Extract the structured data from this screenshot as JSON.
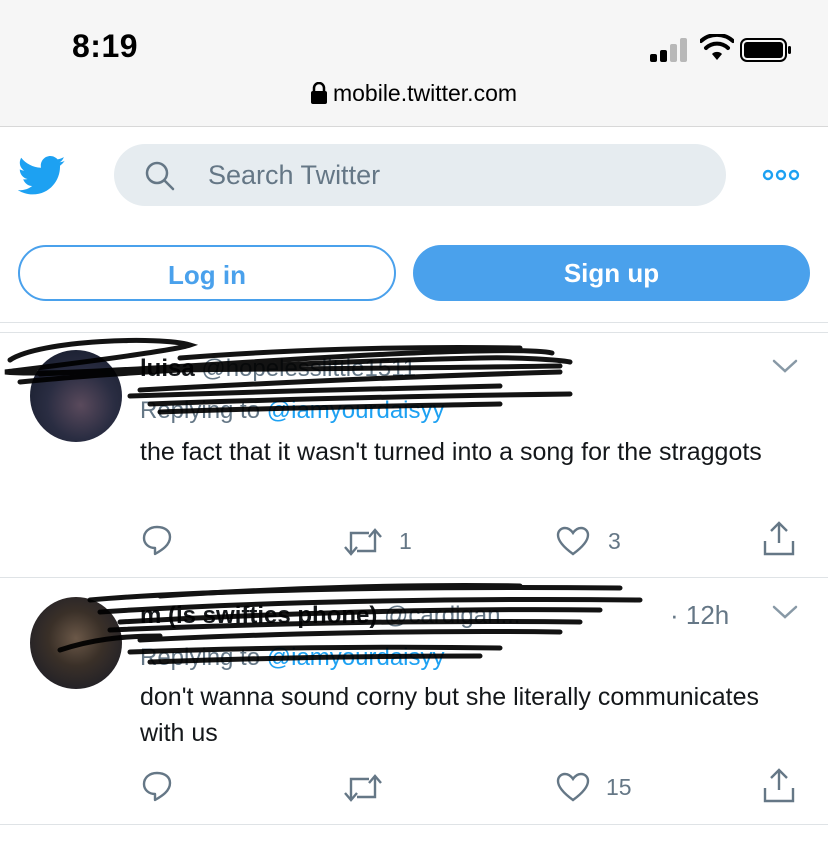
{
  "status_bar": {
    "time": "8:19",
    "url": "mobile.twitter.com"
  },
  "header": {
    "logo": "twitter-bird-icon",
    "search_placeholder": "Search Twitter",
    "more": "more-icon"
  },
  "auth": {
    "login_label": "Log in",
    "signup_label": "Sign up"
  },
  "tweets": [
    {
      "name": "luisa",
      "handle": "@hopelesslittle1511",
      "replying_prefix": "Replying to",
      "replying_handle": "@iamyourdaisyy",
      "text": "the fact that it wasn't turned into a song for the straggots",
      "replies": "",
      "retweets": "1",
      "likes": "3"
    },
    {
      "name": "m (is swifties phone)",
      "handle": "@cardigan...",
      "time": "· 12h",
      "replying_prefix": "Replying to",
      "replying_handle": "@iamyourdaisyy",
      "text": "don't wanna sound corny but she literally communicates with us",
      "replies": "",
      "retweets": "",
      "likes": "15"
    }
  ],
  "colors": {
    "accent": "#4aa1ec",
    "twitter_blue": "#1da1f2",
    "muted": "#657786"
  }
}
